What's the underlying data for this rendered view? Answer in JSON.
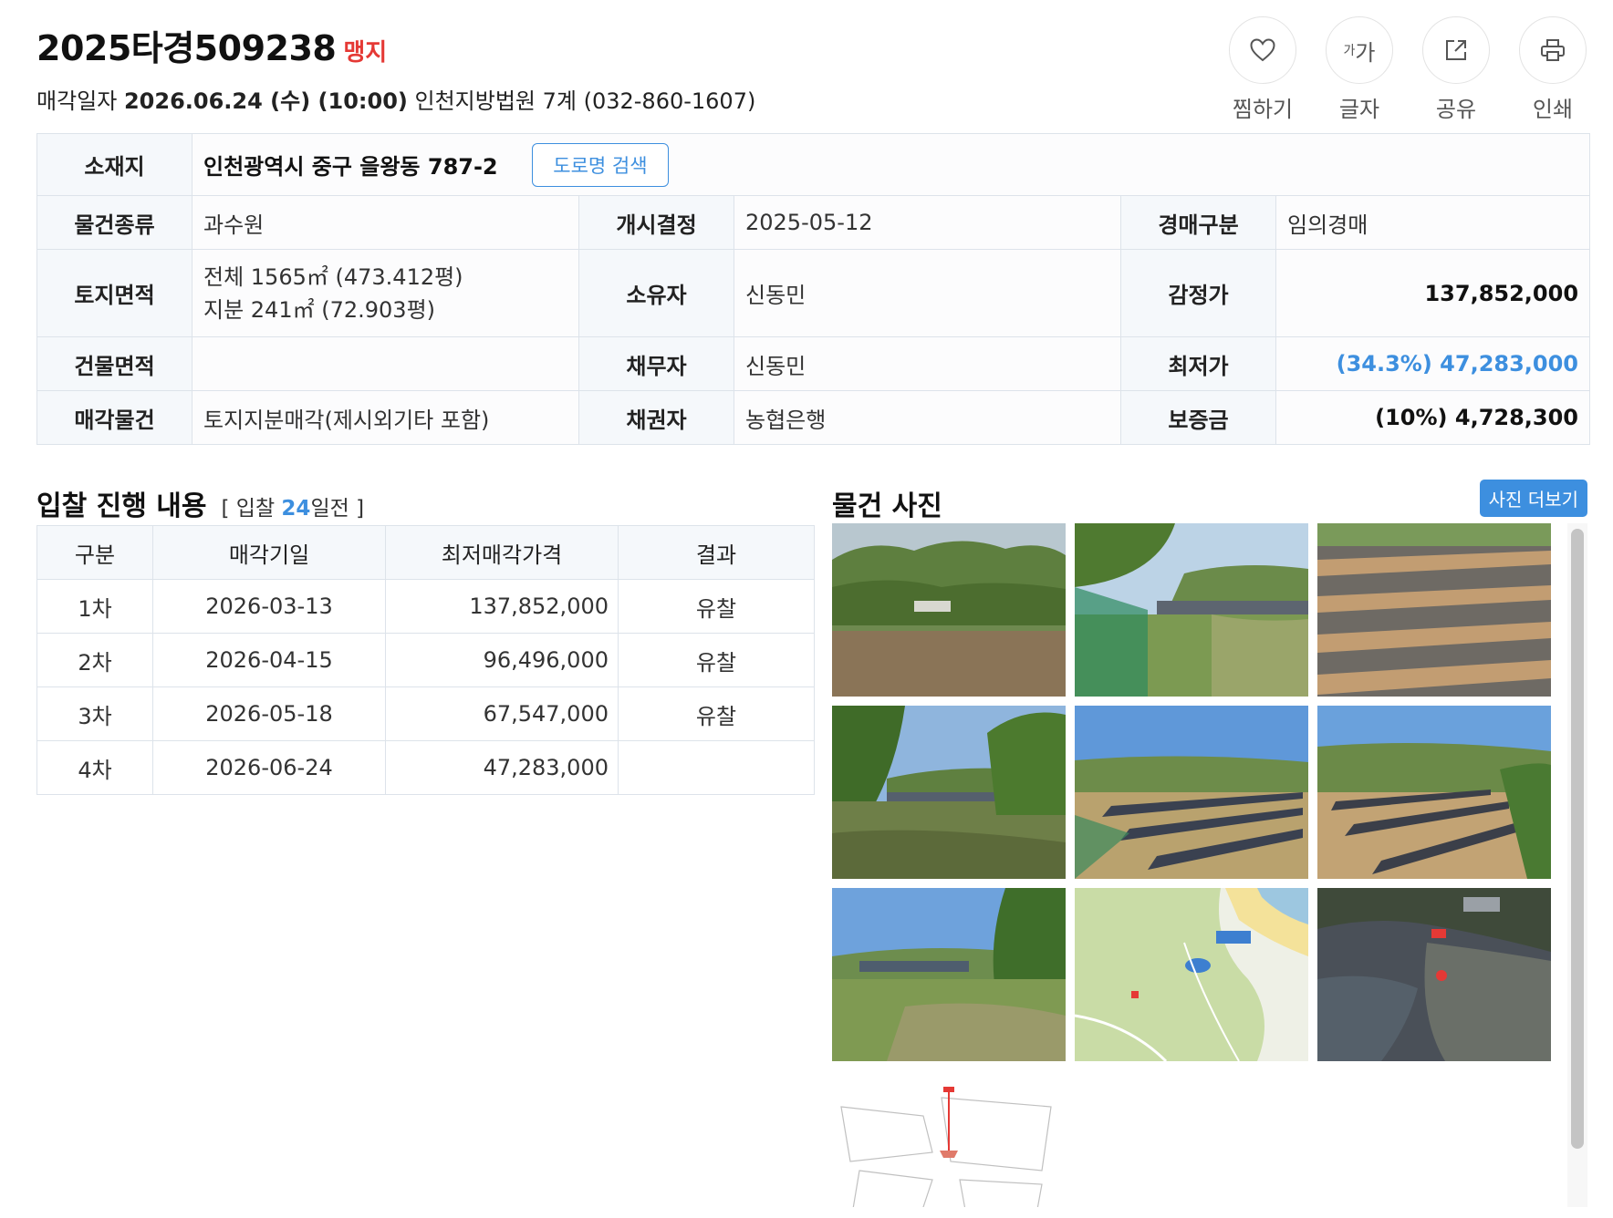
{
  "header": {
    "case_number": "2025타경509238",
    "tag": "맹지",
    "sale_label": "매각일자",
    "sale_date": "2026.06.24 (수) (10:00)",
    "court": "인천지방법원 7계 (032-860-1607)"
  },
  "actions": [
    {
      "label": "찜하기",
      "icon": "heart-icon"
    },
    {
      "label": "글자",
      "icon": "font-size-icon",
      "glyph_small": "가",
      "glyph_big": "가"
    },
    {
      "label": "공유",
      "icon": "share-icon"
    },
    {
      "label": "인쇄",
      "icon": "print-icon"
    }
  ],
  "info": {
    "location_label": "소재지",
    "location": "인천광역시 중구 을왕동 787-2",
    "road_search_label": "도로명 검색",
    "type_label": "물건종류",
    "type": "과수원",
    "start_label": "개시결정",
    "start": "2025-05-12",
    "auction_type_label": "경매구분",
    "auction_type": "임의경매",
    "land_area_label": "토지면적",
    "land_area_total": "전체 1565㎡ (473.412평)",
    "land_area_share": "지분 241㎡ (72.903평)",
    "owner_label": "소유자",
    "owner": "신동민",
    "appraisal_label": "감정가",
    "appraisal": "137,852,000",
    "building_area_label": "건물면적",
    "building_area": "",
    "debtor_label": "채무자",
    "debtor": "신동민",
    "min_price_label": "최저가",
    "min_price": "(34.3%) 47,283,000",
    "sale_item_label": "매각물건",
    "sale_item": "토지지분매각(제시외기타 포함)",
    "creditor_label": "채권자",
    "creditor": "농협은행",
    "deposit_label": "보증금",
    "deposit": "(10%) 4,728,300"
  },
  "bid": {
    "title": "입찰 진행 내용",
    "sub_prefix": "[ 입찰 ",
    "days": "24",
    "sub_suffix": "일전 ]",
    "columns": [
      "구분",
      "매각기일",
      "최저매각가격",
      "결과"
    ],
    "rows": [
      {
        "round": "1차",
        "date": "2026-03-13",
        "price": "137,852,000",
        "result": "유찰"
      },
      {
        "round": "2차",
        "date": "2026-04-15",
        "price": "96,496,000",
        "result": "유찰"
      },
      {
        "round": "3차",
        "date": "2026-05-18",
        "price": "67,547,000",
        "result": "유찰"
      },
      {
        "round": "4차",
        "date": "2026-06-24",
        "price": "47,283,000",
        "result": ""
      }
    ]
  },
  "photos": {
    "title": "물건 사진",
    "more_label": "사진 더보기",
    "items": [
      {
        "name": "photo-pond"
      },
      {
        "name": "photo-field-fence"
      },
      {
        "name": "photo-mulch-rows"
      },
      {
        "name": "photo-field-trees"
      },
      {
        "name": "photo-field-rows-1"
      },
      {
        "name": "photo-field-rows-2"
      },
      {
        "name": "photo-grass-field"
      },
      {
        "name": "photo-map"
      },
      {
        "name": "photo-aerial"
      },
      {
        "name": "photo-cadastral-map"
      }
    ]
  }
}
